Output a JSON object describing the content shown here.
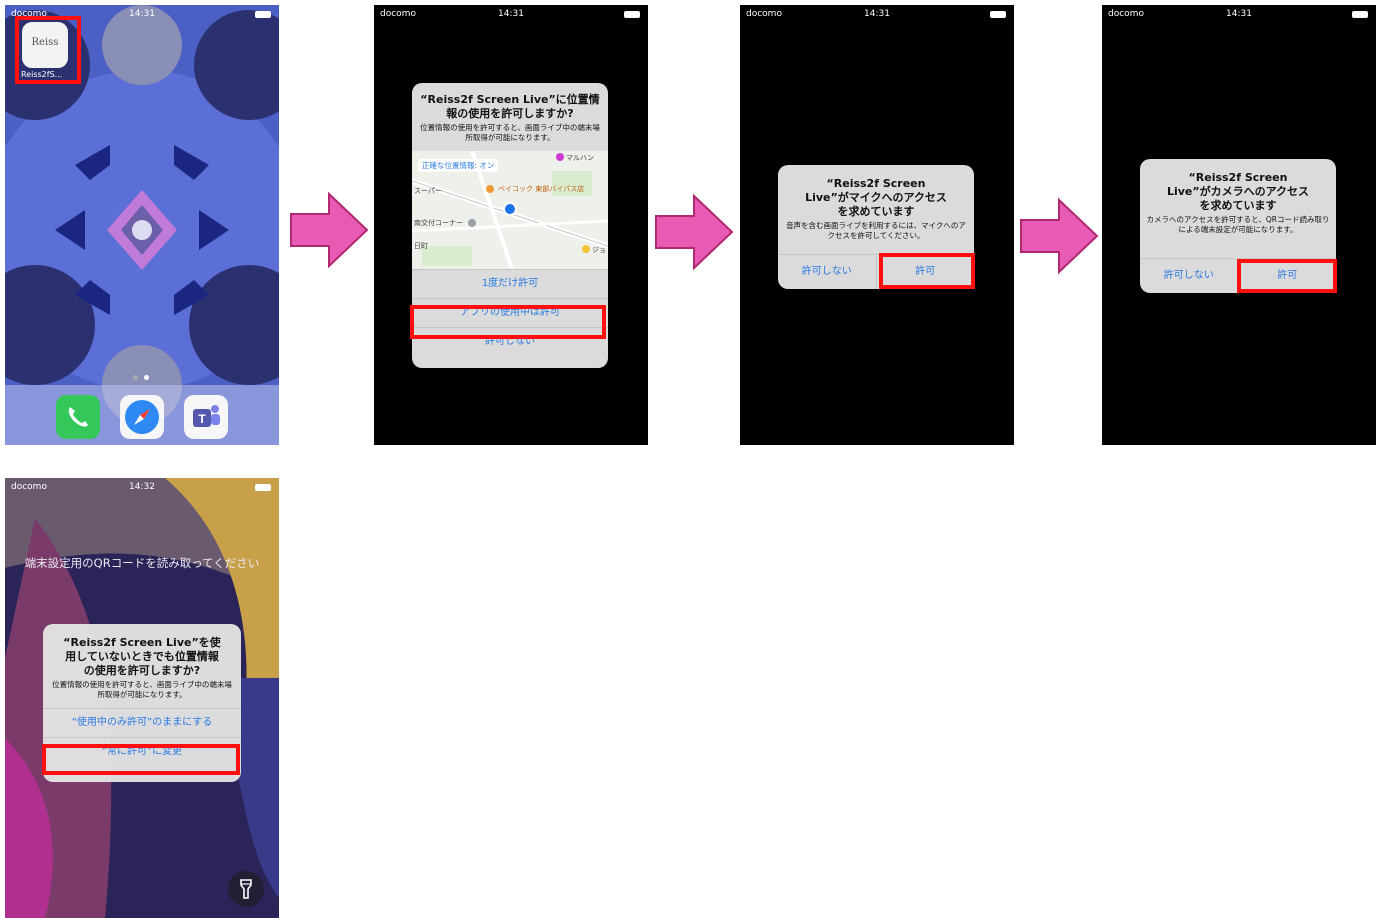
{
  "steps": [
    {
      "status": {
        "carrier": "docomo",
        "time": "14:31"
      },
      "app_icon": {
        "logo_text": "Reiss",
        "label": "Reiss2fS..."
      }
    },
    {
      "status": {
        "carrier": "docomo",
        "time": "14:31"
      },
      "dialog": {
        "title": "“Reiss2f Screen Live”に位置情報の使用を許可しますか?",
        "message": "位置情報の使用を許可すると、画面ライブ中の端末場所取得が可能になります。",
        "map": {
          "precise_label": "正確な位置情報: オン",
          "places": [
            "ベイコック 東部バイパス店",
            "スーパー",
            "南交付コーナー",
            "日町",
            "マルハン",
            "ジョ"
          ]
        },
        "buttons": [
          "1度だけ許可",
          "アプリの使用中は許可",
          "許可しない"
        ]
      }
    },
    {
      "status": {
        "carrier": "docomo",
        "time": "14:31"
      },
      "dialog": {
        "title": "“Reiss2f Screen Live”がマイクへのアクセスを求めています",
        "message": "音声を含む画面ライブを利用するには、マイクへのアクセスを許可してください。",
        "buttons": [
          "許可しない",
          "許可"
        ]
      }
    },
    {
      "status": {
        "carrier": "docomo",
        "time": "14:31"
      },
      "dialog": {
        "title": "“Reiss2f Screen Live”がカメラへのアクセスを求めています",
        "message": "カメラへのアクセスを許可すると、QRコード読み取りによる端末設定が可能になります。",
        "buttons": [
          "許可しない",
          "許可"
        ]
      }
    },
    {
      "status": {
        "carrier": "docomo",
        "time": "14:32"
      },
      "scan_prompt": "端末設定用のQRコードを読み取ってください",
      "dialog": {
        "title": "“Reiss2f Screen Live”を使用していないときでも位置情報の使用を許可しますか?",
        "message": "位置情報の使用を許可すると、画面ライブ中の端末場所取得が可能になります。",
        "buttons": [
          "“使用中のみ許可”のままにする",
          "“常に許可”に変更"
        ]
      }
    }
  ],
  "colors": {
    "highlight": "#ff1010",
    "arrow": "#e85bb4",
    "ios_blue": "#2a7ae2"
  }
}
